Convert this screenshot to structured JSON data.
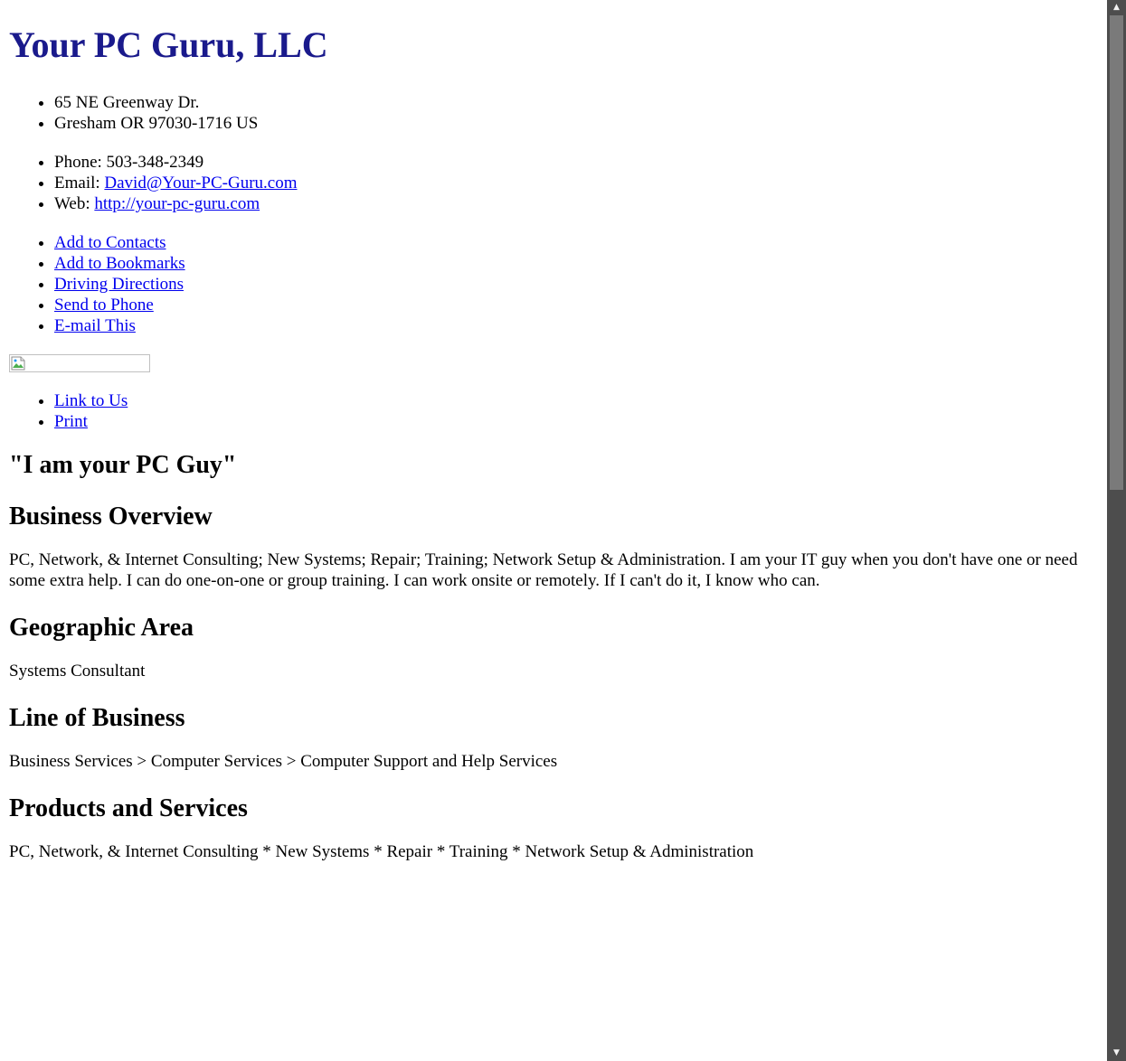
{
  "business": {
    "name": "Your PC Guru, LLC",
    "address": [
      "65 NE Greenway Dr.",
      "Gresham OR 97030-1716 US"
    ],
    "phone_label": "Phone: ",
    "phone": "503-348-2349",
    "email_label": "Email: ",
    "email": "David@Your-PC-Guru.com",
    "web_label": "Web: ",
    "web": "http://your-pc-guru.com"
  },
  "actions": {
    "add_contacts": "Add to Contacts",
    "add_bookmarks": "Add to Bookmarks",
    "driving_directions": "Driving Directions",
    "send_to_phone": "Send to Phone",
    "email_this": "E-mail This"
  },
  "image": {
    "icon": "broken-image-icon"
  },
  "extra_links": {
    "link_to_us": "Link to Us",
    "print": "Print"
  },
  "tagline": "\"I am your PC Guy\"",
  "sections": {
    "overview_heading": "Business Overview",
    "overview_text": "PC, Network, & Internet Consulting; New Systems; Repair; Training; Network Setup & Administration. I am your IT guy when you don't have one or need some extra help. I can do one-on-one or group training. I can work onsite or remotely. If I can't do it, I know who can.",
    "geo_heading": "Geographic Area",
    "geo_text": "Systems Consultant",
    "lob_heading": "Line of Business",
    "lob_text": "Business Services > Computer Services > Computer Support and Help Services",
    "products_heading": "Products and Services",
    "products_text": "PC, Network, & Internet Consulting * New Systems * Repair * Training * Network Setup & Administration"
  },
  "scrollbar": {
    "up_icon": "scroll-up-arrow-icon",
    "down_icon": "scroll-down-arrow-icon"
  },
  "colors": {
    "title": "#1a1a8c",
    "link": "#0000ee",
    "scrollbar_track": "#4d4d4d",
    "scrollbar_thumb": "#7a7a7a"
  }
}
